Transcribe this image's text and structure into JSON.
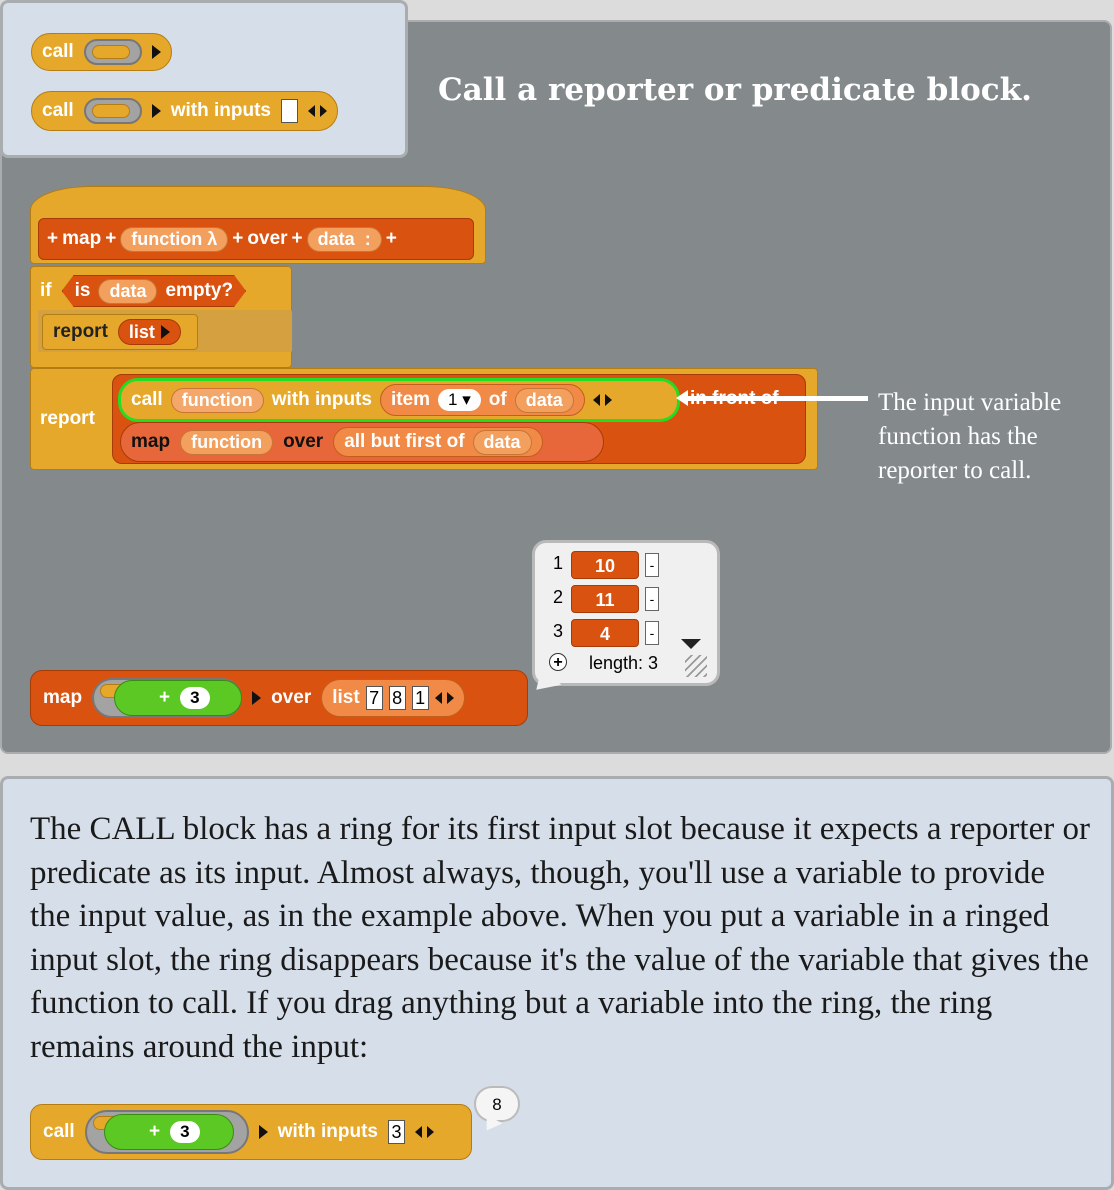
{
  "heading": "Call a reporter or predicate block.",
  "note": "The input variable function has the reporter to call.",
  "paragraph": "The CALL block has a ring for its first input slot because it expects a reporter or predicate as its input. Almost always, though, you'll use a variable to provide the input value, as in the example above. When you put a variable in a ringed input slot, the ring disappears because it's the value of the variable that gives the function to call. If you drag anything but a variable into the ring, the ring remains around the input:",
  "palette": {
    "call_label": "call",
    "call2_label": "call",
    "with_inputs_label": "with inputs"
  },
  "hat": {
    "map": "map",
    "function_param": "function λ",
    "over": "over",
    "data_param": "data",
    "data_colon": ":"
  },
  "if_block": {
    "if": "if",
    "is": "is",
    "data": "data",
    "empty": "empty?"
  },
  "report1": {
    "report": "report",
    "list": "list"
  },
  "report2": {
    "report": "report",
    "call": "call",
    "function": "function",
    "with_inputs": "with inputs",
    "item": "item",
    "item_index": "1",
    "of": "of",
    "data": "data",
    "in_front_of": "in front of",
    "map": "map",
    "function2": "function",
    "over": "over",
    "all_but_first_of": "all but first of",
    "data2": "data"
  },
  "example_map": {
    "map": "map",
    "plus": "+",
    "addend": "3",
    "over": "over",
    "list": "list",
    "items": [
      "7",
      "8",
      "1"
    ]
  },
  "result_bubble": {
    "rows": [
      {
        "index": "1",
        "value": "10"
      },
      {
        "index": "2",
        "value": "11"
      },
      {
        "index": "3",
        "value": "4"
      }
    ],
    "minus_label": "-",
    "plus_label": "+",
    "length_label": "length: 3"
  },
  "bottom_call": {
    "call": "call",
    "plus": "+",
    "addend": "3",
    "with_inputs": "with inputs",
    "input_value": "3",
    "result": "8"
  },
  "colors": {
    "control": "#e6a82b",
    "list": "#d9520f",
    "operators": "#5bc824",
    "variable": "#f39f5e",
    "panel": "#848a8c",
    "info_box": "#d5dee9",
    "highlight": "#22dd22"
  }
}
